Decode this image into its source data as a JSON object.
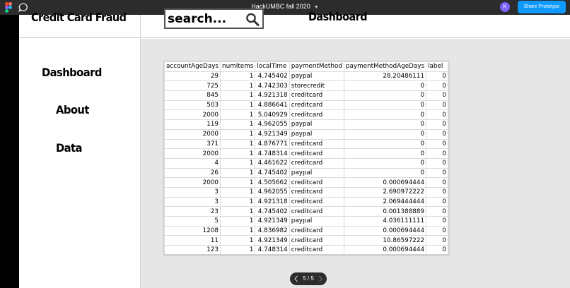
{
  "figma": {
    "file_title": "HackUMBC fall 2020",
    "avatar_initial": "K",
    "share_label": "Share Prototype"
  },
  "header": {
    "brand": "Credit Card Fraud",
    "search_placeholder": "search...",
    "title": "Dashboard"
  },
  "sidebar": {
    "items": [
      {
        "label": "Dashboard"
      },
      {
        "label": "About"
      },
      {
        "label": "Data"
      }
    ]
  },
  "table": {
    "columns": [
      "accountAgeDays",
      "numItems",
      "localTime",
      "paymentMethod",
      "paymentMethodAgeDays",
      "label"
    ],
    "rows": [
      [
        "29",
        "1",
        "4.745402",
        "paypal",
        "28.20486111",
        "0"
      ],
      [
        "725",
        "1",
        "4.742303",
        "storecredit",
        "0",
        "0"
      ],
      [
        "845",
        "1",
        "4.921318",
        "creditcard",
        "0",
        "0"
      ],
      [
        "503",
        "1",
        "4.886641",
        "creditcard",
        "0",
        "0"
      ],
      [
        "2000",
        "1",
        "5.040929",
        "creditcard",
        "0",
        "0"
      ],
      [
        "119",
        "1",
        "4.962055",
        "paypal",
        "0",
        "0"
      ],
      [
        "2000",
        "1",
        "4.921349",
        "paypal",
        "0",
        "0"
      ],
      [
        "371",
        "1",
        "4.876771",
        "creditcard",
        "0",
        "0"
      ],
      [
        "2000",
        "1",
        "4.748314",
        "creditcard",
        "0",
        "0"
      ],
      [
        "4",
        "1",
        "4.461622",
        "creditcard",
        "0",
        "0"
      ],
      [
        "26",
        "1",
        "4.745402",
        "paypal",
        "0",
        "0"
      ],
      [
        "2000",
        "1",
        "4.505662",
        "creditcard",
        "0.000694444",
        "0"
      ],
      [
        "3",
        "1",
        "4.962055",
        "creditcard",
        "2.690972222",
        "0"
      ],
      [
        "3",
        "1",
        "4.921318",
        "creditcard",
        "2.069444444",
        "0"
      ],
      [
        "23",
        "1",
        "4.745402",
        "creditcard",
        "0.001388889",
        "0"
      ],
      [
        "5",
        "1",
        "4.921349",
        "paypal",
        "4.036111111",
        "0"
      ],
      [
        "1208",
        "1",
        "4.836982",
        "creditcard",
        "0.000694444",
        "0"
      ],
      [
        "11",
        "1",
        "4.921349",
        "creditcard",
        "10.86597222",
        "0"
      ],
      [
        "123",
        "1",
        "4.748314",
        "creditcard",
        "0.000694444",
        "0"
      ]
    ]
  },
  "pager": {
    "count": "5 / 5"
  },
  "colors": {
    "figma_bar": "#2c2c2c",
    "share_button": "#0d99ff",
    "avatar": "#7b61ff",
    "canvas": "#e6e6e6"
  },
  "icons": [
    "figma-logo-icon",
    "comment-icon",
    "chevron-down-icon",
    "search-icon",
    "chevron-left-icon",
    "chevron-right-icon"
  ]
}
